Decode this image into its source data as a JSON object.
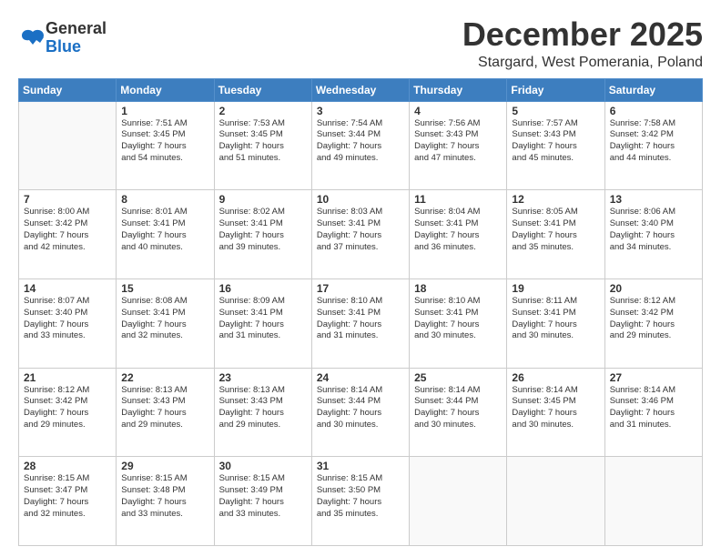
{
  "header": {
    "logo": {
      "line1": "General",
      "line2": "Blue"
    },
    "title": "December 2025",
    "location": "Stargard, West Pomerania, Poland"
  },
  "days_of_week": [
    "Sunday",
    "Monday",
    "Tuesday",
    "Wednesday",
    "Thursday",
    "Friday",
    "Saturday"
  ],
  "weeks": [
    [
      {
        "day": "",
        "info": ""
      },
      {
        "day": "1",
        "info": "Sunrise: 7:51 AM\nSunset: 3:45 PM\nDaylight: 7 hours\nand 54 minutes."
      },
      {
        "day": "2",
        "info": "Sunrise: 7:53 AM\nSunset: 3:45 PM\nDaylight: 7 hours\nand 51 minutes."
      },
      {
        "day": "3",
        "info": "Sunrise: 7:54 AM\nSunset: 3:44 PM\nDaylight: 7 hours\nand 49 minutes."
      },
      {
        "day": "4",
        "info": "Sunrise: 7:56 AM\nSunset: 3:43 PM\nDaylight: 7 hours\nand 47 minutes."
      },
      {
        "day": "5",
        "info": "Sunrise: 7:57 AM\nSunset: 3:43 PM\nDaylight: 7 hours\nand 45 minutes."
      },
      {
        "day": "6",
        "info": "Sunrise: 7:58 AM\nSunset: 3:42 PM\nDaylight: 7 hours\nand 44 minutes."
      }
    ],
    [
      {
        "day": "7",
        "info": ""
      },
      {
        "day": "8",
        "info": "Sunrise: 8:01 AM\nSunset: 3:41 PM\nDaylight: 7 hours\nand 40 minutes."
      },
      {
        "day": "9",
        "info": "Sunrise: 8:02 AM\nSunset: 3:41 PM\nDaylight: 7 hours\nand 39 minutes."
      },
      {
        "day": "10",
        "info": "Sunrise: 8:03 AM\nSunset: 3:41 PM\nDaylight: 7 hours\nand 37 minutes."
      },
      {
        "day": "11",
        "info": "Sunrise: 8:04 AM\nSunset: 3:41 PM\nDaylight: 7 hours\nand 36 minutes."
      },
      {
        "day": "12",
        "info": "Sunrise: 8:05 AM\nSunset: 3:41 PM\nDaylight: 7 hours\nand 35 minutes."
      },
      {
        "day": "13",
        "info": "Sunrise: 8:06 AM\nSunset: 3:40 PM\nDaylight: 7 hours\nand 34 minutes."
      }
    ],
    [
      {
        "day": "14",
        "info": ""
      },
      {
        "day": "15",
        "info": "Sunrise: 8:08 AM\nSunset: 3:41 PM\nDaylight: 7 hours\nand 32 minutes."
      },
      {
        "day": "16",
        "info": "Sunrise: 8:09 AM\nSunset: 3:41 PM\nDaylight: 7 hours\nand 31 minutes."
      },
      {
        "day": "17",
        "info": "Sunrise: 8:10 AM\nSunset: 3:41 PM\nDaylight: 7 hours\nand 31 minutes."
      },
      {
        "day": "18",
        "info": "Sunrise: 8:10 AM\nSunset: 3:41 PM\nDaylight: 7 hours\nand 30 minutes."
      },
      {
        "day": "19",
        "info": "Sunrise: 8:11 AM\nSunset: 3:41 PM\nDaylight: 7 hours\nand 30 minutes."
      },
      {
        "day": "20",
        "info": "Sunrise: 8:12 AM\nSunset: 3:42 PM\nDaylight: 7 hours\nand 29 minutes."
      }
    ],
    [
      {
        "day": "21",
        "info": ""
      },
      {
        "day": "22",
        "info": "Sunrise: 8:13 AM\nSunset: 3:43 PM\nDaylight: 7 hours\nand 29 minutes."
      },
      {
        "day": "23",
        "info": "Sunrise: 8:13 AM\nSunset: 3:43 PM\nDaylight: 7 hours\nand 29 minutes."
      },
      {
        "day": "24",
        "info": "Sunrise: 8:14 AM\nSunset: 3:44 PM\nDaylight: 7 hours\nand 30 minutes."
      },
      {
        "day": "25",
        "info": "Sunrise: 8:14 AM\nSunset: 3:44 PM\nDaylight: 7 hours\nand 30 minutes."
      },
      {
        "day": "26",
        "info": "Sunrise: 8:14 AM\nSunset: 3:45 PM\nDaylight: 7 hours\nand 30 minutes."
      },
      {
        "day": "27",
        "info": "Sunrise: 8:14 AM\nSunset: 3:46 PM\nDaylight: 7 hours\nand 31 minutes."
      }
    ],
    [
      {
        "day": "28",
        "info": ""
      },
      {
        "day": "29",
        "info": "Sunrise: 8:15 AM\nSunset: 3:48 PM\nDaylight: 7 hours\nand 33 minutes."
      },
      {
        "day": "30",
        "info": "Sunrise: 8:15 AM\nSunset: 3:49 PM\nDaylight: 7 hours\nand 33 minutes."
      },
      {
        "day": "31",
        "info": "Sunrise: 8:15 AM\nSunset: 3:50 PM\nDaylight: 7 hours\nand 35 minutes."
      },
      {
        "day": "",
        "info": ""
      },
      {
        "day": "",
        "info": ""
      },
      {
        "day": "",
        "info": ""
      }
    ]
  ],
  "week7_sun": "Sunrise: 8:00 AM\nSunset: 3:42 PM\nDaylight: 7 hours\nand 42 minutes.",
  "week14_sun": "Sunrise: 8:07 AM\nSunset: 3:40 PM\nDaylight: 7 hours\nand 33 minutes.",
  "week21_sun": "Sunrise: 8:12 AM\nSunset: 3:42 PM\nDaylight: 7 hours\nand 29 minutes.",
  "week28_sun": "Sunrise: 8:15 AM\nSunset: 3:47 PM\nDaylight: 7 hours\nand 32 minutes."
}
